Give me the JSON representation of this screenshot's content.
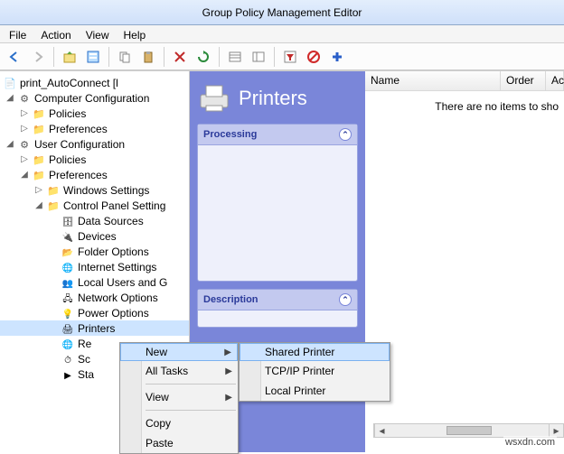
{
  "window": {
    "title": "Group Policy Management Editor"
  },
  "menubar": [
    "File",
    "Action",
    "View",
    "Help"
  ],
  "tree": {
    "root": "print_AutoConnect [l",
    "comp_cfg": "Computer Configuration",
    "comp_policies": "Policies",
    "comp_prefs": "Preferences",
    "user_cfg": "User Configuration",
    "user_policies": "Policies",
    "user_prefs": "Preferences",
    "win_settings": "Windows Settings",
    "cp_settings": "Control Panel Setting",
    "cp_items": {
      "data_sources": "Data Sources",
      "devices": "Devices",
      "folder_options": "Folder Options",
      "internet": "Internet Settings",
      "local_users": "Local Users and G",
      "network": "Network Options",
      "power": "Power Options",
      "printers": "Printers",
      "regional": "Re",
      "scheduled": "Sc",
      "start_menu": "Sta"
    }
  },
  "detail": {
    "header": "Printers",
    "panel1": "Processing",
    "panel2": "Description"
  },
  "list": {
    "col_name": "Name",
    "col_order": "Order",
    "col_action": "Ac",
    "empty": "There are no items to sho"
  },
  "ctx1": {
    "new": "New",
    "all_tasks": "All Tasks",
    "view": "View",
    "copy": "Copy",
    "paste": "Paste"
  },
  "ctx2": {
    "shared": "Shared Printer",
    "tcpip": "TCP/IP Printer",
    "local": "Local Printer"
  },
  "watermark": "wsxdn.com"
}
